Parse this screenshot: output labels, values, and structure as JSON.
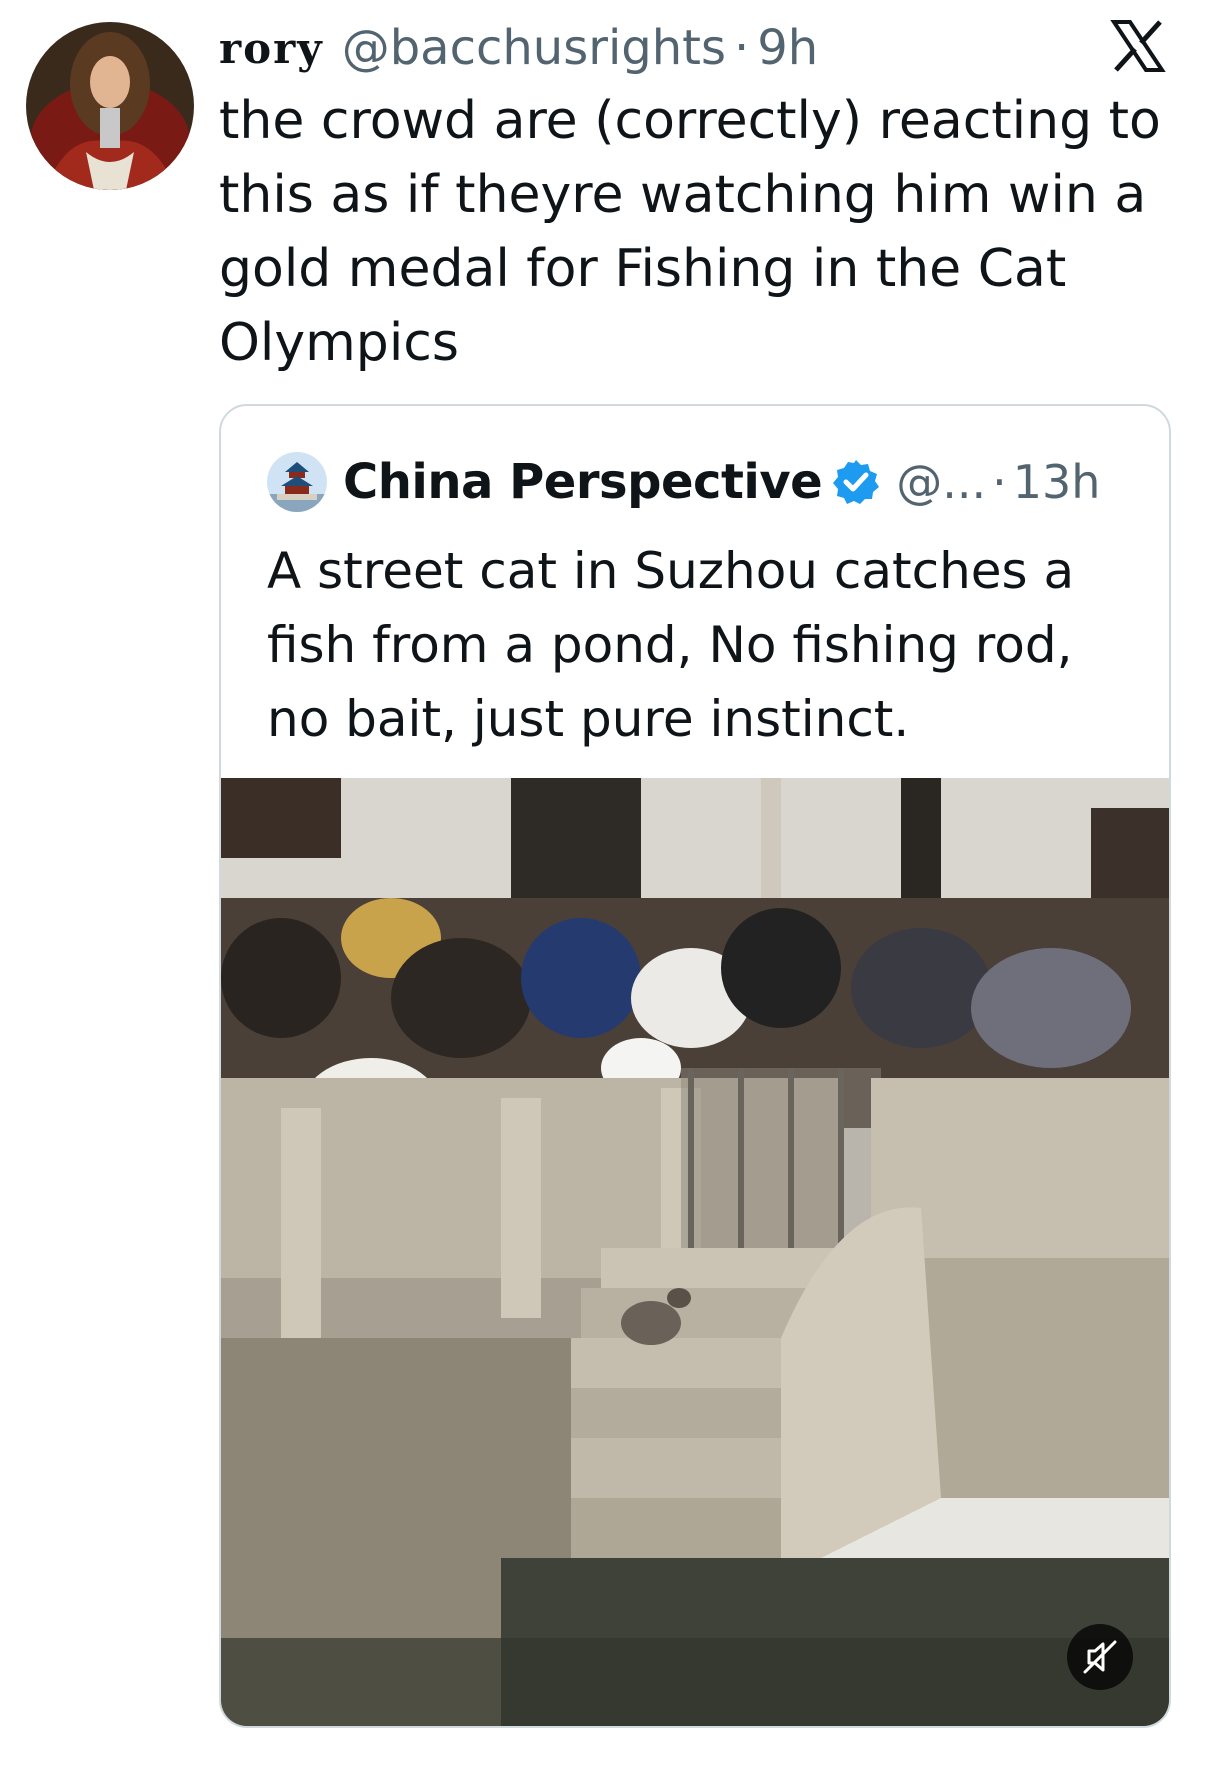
{
  "tweet": {
    "author_name": "rory",
    "author_handle": "@bacchusrights",
    "separator": "·",
    "time": "9h",
    "text": "the crowd are (correctly) reacting to this as if theyre watching him win a gold medal for Fishing in the Cat Olympics",
    "platform_icon": "x-logo-icon"
  },
  "quote": {
    "author_name": "China Perspective",
    "verified": true,
    "author_handle": "@...",
    "separator": "·",
    "time": "13h",
    "text": "A street cat in Suzhou catches a fish from a pond, No fishing rod, no bait, just pure instinct.",
    "media": {
      "type": "video",
      "muted": true,
      "mute_icon": "speaker-muted-icon"
    }
  },
  "colors": {
    "text": "#0f1419",
    "secondary": "#536471",
    "border": "#cfd9de",
    "verified_blue": "#1d9bf0"
  }
}
